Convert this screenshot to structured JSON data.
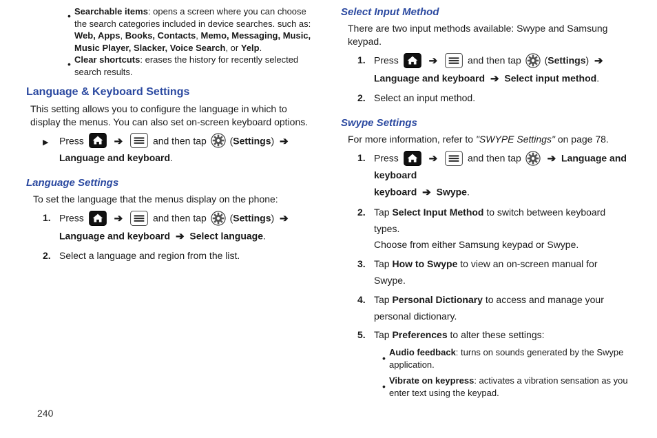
{
  "col1": {
    "bullets": [
      {
        "lead": "Searchable items",
        "rest": ": opens a screen where you can choose the search categories included in device searches. such as: ",
        "bold_list": "Web, Apps",
        "mid": ", ",
        "bold_list2": "Books, Contacts",
        "mid2": ", ",
        "bold_list3": "Memo, Messaging, Music, Music Player, Slacker, Voice Search",
        "tail": ", or ",
        "bold_last": "Yelp",
        "period": "."
      },
      {
        "lead": "Clear shortcuts",
        "rest": ": erases the history for recently selected search results."
      }
    ],
    "section_title": "Language & Keyboard Settings",
    "section_intro": "This setting allows you to configure the language in which to display the menus. You can also set on-screen keyboard options.",
    "press": "Press ",
    "and_then_tap": " and then tap ",
    "settings_open": " (",
    "settings_word": "Settings",
    "settings_close": ") ",
    "arrow": " ➔ ",
    "lang_kbd": "Language and keyboard",
    "period": ".",
    "sub1_title": "Language Settings",
    "sub1_intro": "To set the language that the menus display on the phone:",
    "select_language": "Select language",
    "step2": "Select a language and region from the list."
  },
  "col2": {
    "sub2_title": "Select Input Method",
    "sub2_intro": "There are two input methods available: Swype and Samsung keypad.",
    "select_input_method": "Select input method",
    "step2": "Select an input method.",
    "sub3_title": "Swype Settings",
    "sub3_intro_a": "For more information, refer to ",
    "sub3_ref": "\"SWYPE Settings\"",
    "sub3_intro_b": " on page 78.",
    "swype": "Swype",
    "s_step2_a": "Tap ",
    "s_step2_bold": "Select Input Method",
    "s_step2_b": " to switch between keyboard types.",
    "s_step2_line2": "Choose from either Samsung keypad or Swype.",
    "s_step3_a": "Tap ",
    "s_step3_bold": "How to Swype",
    "s_step3_b": " to view an on-screen manual for Swype.",
    "s_step4_a": "Tap ",
    "s_step4_bold": "Personal Dictionary",
    "s_step4_b": " to access and manage your",
    "s_step4_line2": "personal dictionary.",
    "s_step5_a": "Tap ",
    "s_step5_bold": "Preferences",
    "s_step5_b": " to alter these settings:",
    "pref_bullets": [
      {
        "lead": "Audio feedback",
        "rest": ": turns on sounds generated by the Swype application."
      },
      {
        "lead": "Vibrate on keypress",
        "rest": ": activates a vibration sensation as you enter text using the keypad."
      }
    ]
  },
  "markers": {
    "n1": "1.",
    "n2": "2.",
    "n3": "3.",
    "n4": "4.",
    "n5": "5."
  },
  "page_number": "240"
}
